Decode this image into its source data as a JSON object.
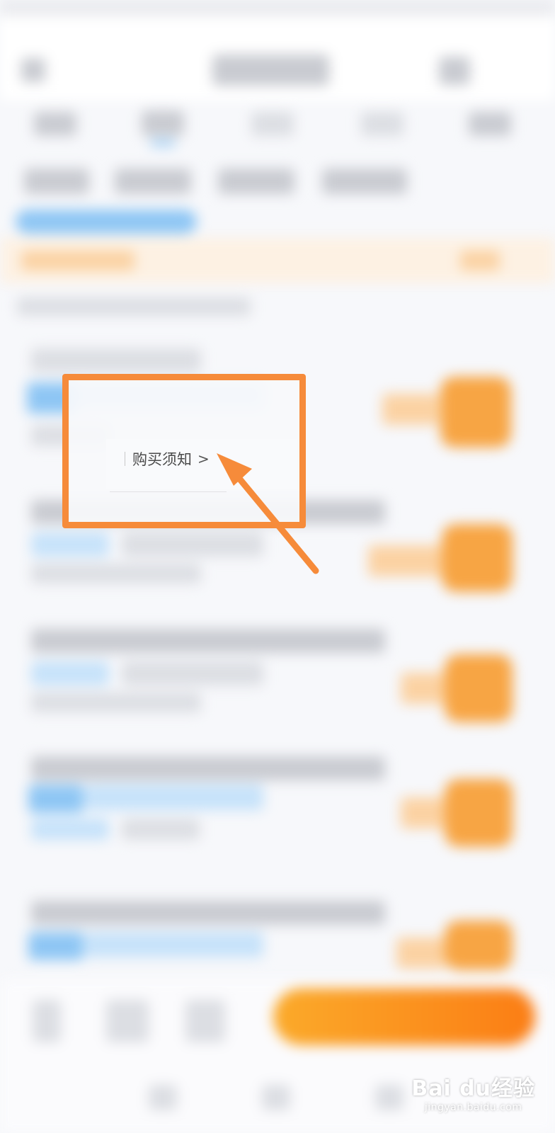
{
  "annotation": {
    "link_label": "购买须知",
    "chevron": ">",
    "accent": "#f68b3a"
  },
  "watermark": {
    "logo": "Bai du经验",
    "url": "jingyan.baidu.com"
  },
  "icons": {
    "arrow": "arrow-up-left-icon",
    "chevron": "chevron-right-icon"
  }
}
